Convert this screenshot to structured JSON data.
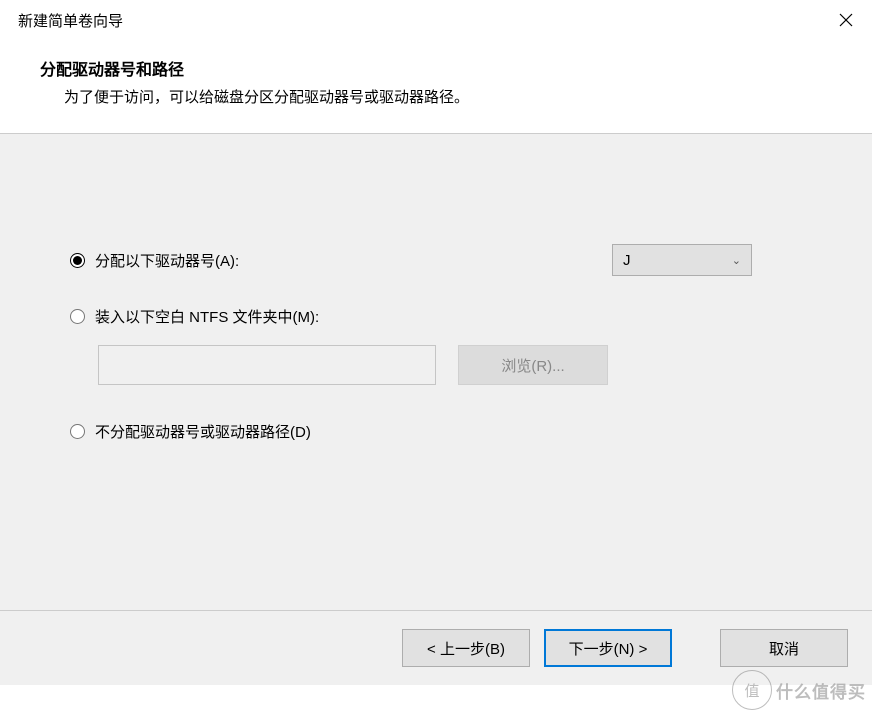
{
  "titlebar": {
    "title": "新建简单卷向导"
  },
  "header": {
    "title": "分配驱动器号和路径",
    "subtitle": "为了便于访问，可以给磁盘分区分配驱动器号或驱动器路径。"
  },
  "options": {
    "assign_letter": {
      "label": "分配以下驱动器号(A):",
      "selected_value": "J"
    },
    "mount_folder": {
      "label": "装入以下空白 NTFS 文件夹中(M):",
      "path_value": "",
      "browse_label": "浏览(R)..."
    },
    "no_assign": {
      "label": "不分配驱动器号或驱动器路径(D)"
    }
  },
  "footer": {
    "back": "< 上一步(B)",
    "next": "下一步(N) >",
    "cancel": "取消"
  },
  "watermark": {
    "circle": "值",
    "text": "什么值得买"
  }
}
